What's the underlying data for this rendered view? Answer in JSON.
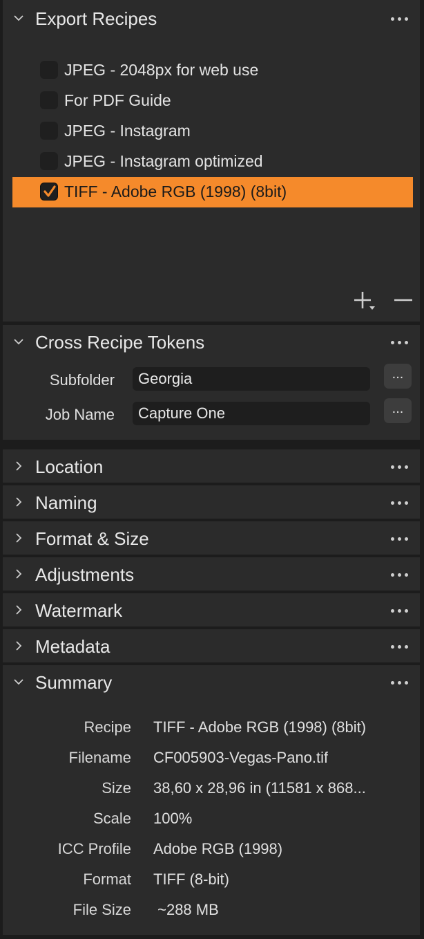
{
  "export_recipes": {
    "title": "Export Recipes",
    "items": [
      {
        "label": "JPEG - 2048px for web use",
        "checked": false
      },
      {
        "label": "For PDF Guide",
        "checked": false
      },
      {
        "label": "JPEG - Instagram",
        "checked": false
      },
      {
        "label": "JPEG - Instagram optimized",
        "checked": false
      },
      {
        "label": "TIFF - Adobe RGB (1998) (8bit)",
        "checked": true
      }
    ]
  },
  "cross_recipe_tokens": {
    "title": "Cross Recipe Tokens",
    "subfolder": {
      "label": "Subfolder",
      "value": "Georgia",
      "button": "..."
    },
    "job_name": {
      "label": "Job Name",
      "value": "Capture One",
      "button": "..."
    }
  },
  "sections": {
    "location": "Location",
    "naming": "Naming",
    "format_size": "Format & Size",
    "adjustments": "Adjustments",
    "watermark": "Watermark",
    "metadata": "Metadata"
  },
  "summary": {
    "title": "Summary",
    "rows": [
      {
        "label": "Recipe",
        "value": "TIFF - Adobe RGB (1998) (8bit)"
      },
      {
        "label": "Filename",
        "value": "CF005903-Vegas-Pano.tif"
      },
      {
        "label": "Size",
        "value": "38,60 x 28,96 in (11581 x 868..."
      },
      {
        "label": "Scale",
        "value": "100%"
      },
      {
        "label": "ICC Profile",
        "value": "Adobe RGB (1998)"
      },
      {
        "label": "Format",
        "value": "TIFF (8-bit)"
      },
      {
        "label": "File Size",
        "value": " ~288 MB"
      }
    ]
  },
  "colors": {
    "accent": "#f58a2b",
    "panel": "#2b2b2b",
    "background": "#1c1c1c"
  }
}
